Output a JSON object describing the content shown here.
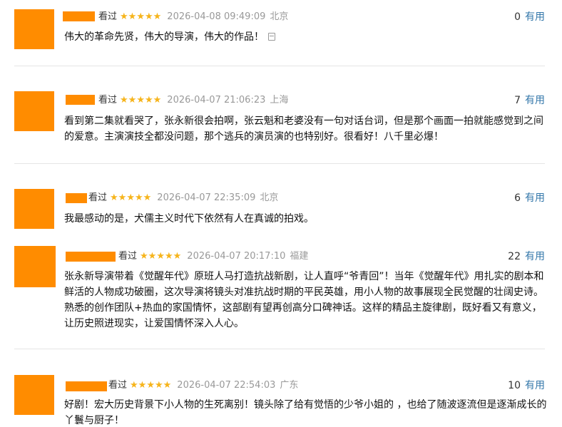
{
  "reviews": [
    {
      "rating_label": "看过",
      "stars": "★★★★★",
      "time": "2026-04-08 09:49:09",
      "location": "北京",
      "votes": "0",
      "vote_label": "有用",
      "content": "伟大的革命先贤，伟大的导演，伟大的作品！",
      "note_icon": "document-icon"
    },
    {
      "rating_label": "看过",
      "stars": "★★★★★",
      "time": "2026-04-07 21:06:23",
      "location": "上海",
      "votes": "7",
      "vote_label": "有用",
      "content": "看到第二集就看哭了，张永新很会拍啊，张云魁和老婆没有一句对话台词，但是那个画面一拍就能感觉到之间的爱意。主演演技全都没问题，那个逃兵的演员演的也特别好。很看好！八千里必爆！"
    },
    {
      "rating_label": "看过",
      "stars": "★★★★★",
      "time": "2026-04-07 22:35:09",
      "location": "北京",
      "votes": "6",
      "vote_label": "有用",
      "content": "我最感动的是，犬儒主义时代下依然有人在真诚的拍戏。"
    },
    {
      "rating_label": "看过",
      "stars": "★★★★★",
      "time": "2026-04-07 20:17:10",
      "location": "福建",
      "votes": "22",
      "vote_label": "有用",
      "content": "张永新导演带着《觉醒年代》原班人马打造抗战新剧，让人直呼“爷青回”！当年《觉醒年代》用扎实的剧本和鲜活的人物成功破圈，这次导演将镜头对准抗战时期的平民英雄，用小人物的故事展现全民觉醒的壮阔史诗。熟悉的创作团队+热血的家国情怀，这部剧有望再创高分口碑神话。这样的精品主旋律剧，既好看又有意义，让历史照进现实，让爱国情怀深入人心。"
    },
    {
      "rating_label": "看过",
      "stars": "★★★★★",
      "time": "2026-04-07 22:54:03",
      "location": "广东",
      "votes": "10",
      "vote_label": "有用",
      "content": "好剧！宏大历史背景下小人物的生死离别！镜头除了给有觉悟的少爷小姐的 ，也给了随波逐流但是逐渐成长的丫鬟与厨子！"
    }
  ],
  "colors": {
    "avatar": "#FF8C00",
    "stars": "#F6B41B",
    "link": "#3377AA",
    "meta": "#999999"
  }
}
